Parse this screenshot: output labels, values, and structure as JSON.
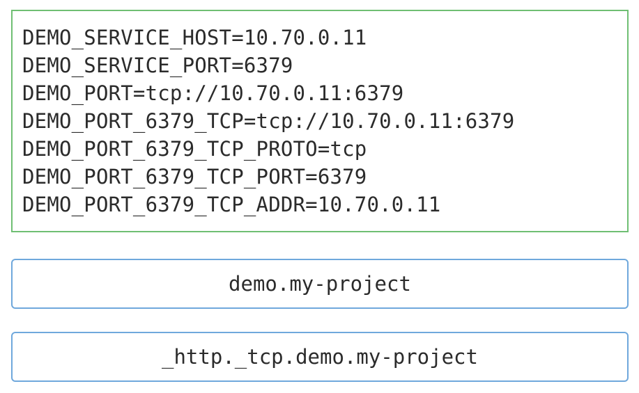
{
  "env_vars": [
    "DEMO_SERVICE_HOST=10.70.0.11",
    "DEMO_SERVICE_PORT=6379",
    "DEMO_PORT=tcp://10.70.0.11:6379",
    "DEMO_PORT_6379_TCP=tcp://10.70.0.11:6379",
    "DEMO_PORT_6379_TCP_PROTO=tcp",
    "DEMO_PORT_6379_TCP_PORT=6379",
    "DEMO_PORT_6379_TCP_ADDR=10.70.0.11"
  ],
  "dns_names": [
    "demo.my-project",
    "_http._tcp.demo.my-project"
  ],
  "colors": {
    "env_border": "#6fbf73",
    "dns_border": "#6fa8dc",
    "text": "#2b2b2b"
  }
}
